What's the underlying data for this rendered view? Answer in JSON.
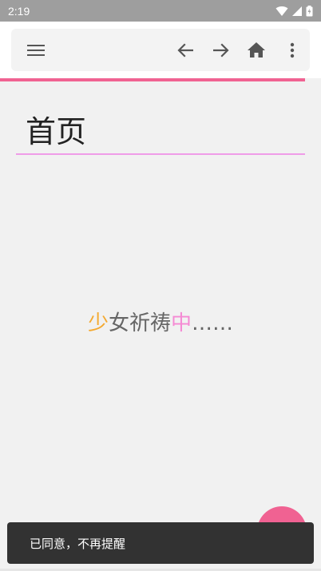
{
  "status_bar": {
    "time": "2:19",
    "icons": [
      "wifi-icon",
      "signal-icon",
      "battery-icon"
    ]
  },
  "toolbar": {
    "menu_icon": "menu-icon",
    "back_icon": "arrow-back-icon",
    "forward_icon": "arrow-forward-icon",
    "home_icon": "home-icon",
    "more_icon": "more-vert-icon"
  },
  "page": {
    "title": "首页"
  },
  "message": {
    "part1": "少",
    "part2": "女祈祷",
    "part3": "中",
    "part4": "……"
  },
  "snackbar": {
    "text": "已同意，不再提醒"
  },
  "colors": {
    "accent": "#f06292",
    "title_underline": "#ef9ce8",
    "message_orange": "#f4a930",
    "message_pink": "#f58ad4",
    "message_gray": "#666666",
    "status_bar": "#9e9e9e",
    "snackbar_bg": "#323232"
  }
}
